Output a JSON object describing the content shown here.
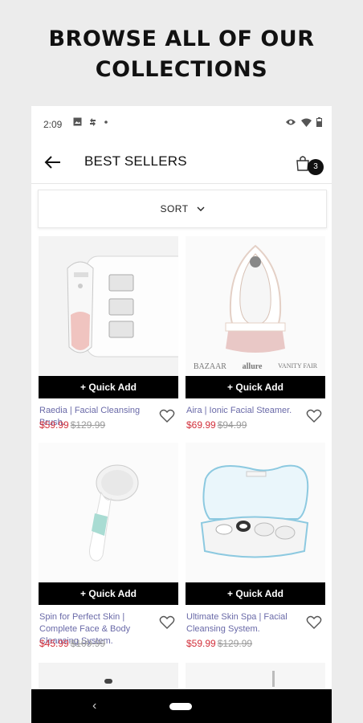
{
  "headline": "BROWSE ALL OF OUR COLLECTIONS",
  "status_bar": {
    "time": "2:09"
  },
  "header": {
    "title": "BEST SELLERS",
    "cart_count": "3"
  },
  "sort": {
    "label": "SORT"
  },
  "products": [
    {
      "name": "Raedia | Facial Cleansing Brush.",
      "price": "$59.99",
      "original_price": "$129.99",
      "button": "+ Quick Add"
    },
    {
      "name": "Aira | Ionic Facial Steamer.",
      "price": "$69.99",
      "original_price": "$94.99",
      "button": "+ Quick Add",
      "brands": [
        "BAZAAR",
        "allure",
        "VANITY FAIR"
      ]
    },
    {
      "name": "Spin for Perfect Skin | Complete Face & Body Cleansing System.",
      "price": "$45.99",
      "original_price": "$109.99",
      "button": "+ Quick Add"
    },
    {
      "name": "Ultimate Skin Spa | Facial Cleansing System.",
      "price": "$59.99",
      "original_price": "$129.99",
      "button": "+ Quick Add"
    }
  ],
  "colors": {
    "sale_price": "#d2303b",
    "product_name": "#6a6aa8",
    "quick_add_bg": "#000000"
  }
}
